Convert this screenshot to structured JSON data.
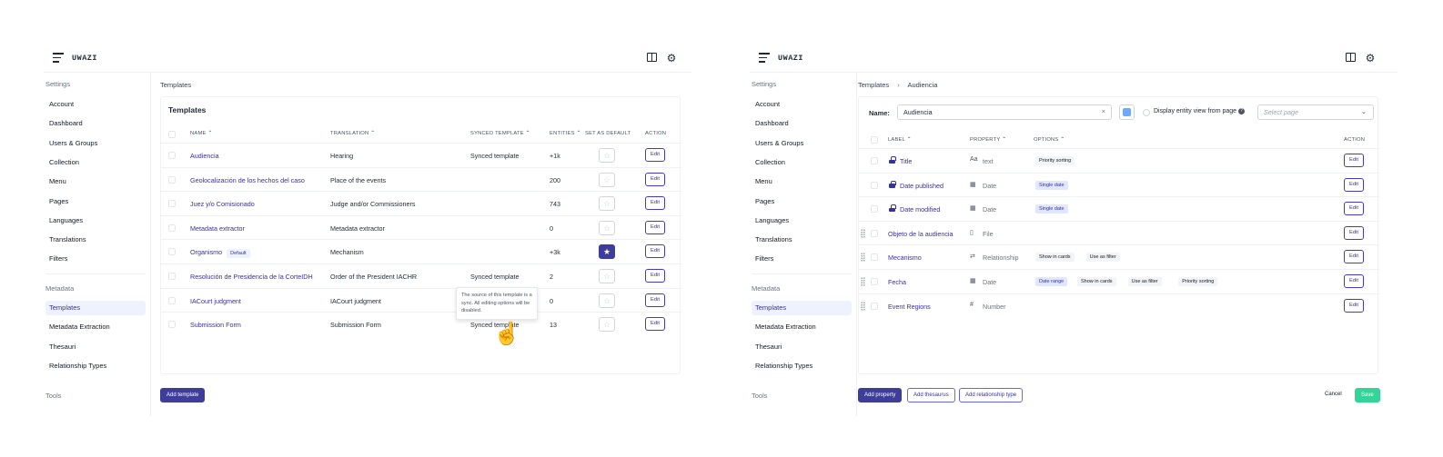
{
  "app": {
    "brand": "UWAZI"
  },
  "sidebar": {
    "settings_heading": "Settings",
    "settings_items": [
      "Account",
      "Dashboard",
      "Users & Groups",
      "Collection",
      "Menu",
      "Pages",
      "Languages",
      "Translations",
      "Filters"
    ],
    "metadata_heading": "Metadata",
    "metadata_items": [
      "Templates",
      "Metadata Extraction",
      "Thesauri",
      "Relationship Types"
    ],
    "tools_heading": "Tools"
  },
  "left": {
    "breadcrumb": "Templates",
    "card_title": "Templates",
    "columns": {
      "name": "NAME",
      "translation": "TRANSLATION",
      "synced": "SYNCED TEMPLATE",
      "entities": "ENTITIES",
      "default": "SET AS DEFAULT",
      "action": "ACTION"
    },
    "default_badge": "Default",
    "edit_label": "Edit",
    "rows": [
      {
        "name": "Audiencia",
        "translation": "Hearing",
        "synced": "Synced template",
        "entities": "+1k",
        "is_default": false
      },
      {
        "name": "Geolocalización de los hechos del caso",
        "translation": "Place of the events",
        "synced": "",
        "entities": "200",
        "is_default": false
      },
      {
        "name": "Juez y/o Comisionado",
        "translation": "Judge and/or Commissioners",
        "synced": "",
        "entities": "743",
        "is_default": false
      },
      {
        "name": "Metadata extractor",
        "translation": "Metadata extractor",
        "synced": "",
        "entities": "0",
        "is_default": false
      },
      {
        "name": "Organismo",
        "translation": "Mechanism",
        "synced": "",
        "entities": "+3k",
        "is_default": true
      },
      {
        "name": "Resolución de Presidencia de la CorteIDH",
        "translation": "Order of the President IACHR",
        "synced": "Synced template",
        "entities": "2",
        "is_default": false
      },
      {
        "name": "IACourt judgment",
        "translation": "IACourt judgment",
        "synced": "",
        "entities": "0",
        "is_default": false
      },
      {
        "name": "Submission Form",
        "translation": "Submission Form",
        "synced": "Synced template",
        "entities": "13",
        "is_default": false
      }
    ],
    "tooltip": "The source of this template is a sync. All editing options will be disabled.",
    "add_button": "Add template"
  },
  "right": {
    "breadcrumb": [
      "Templates",
      "Audiencia"
    ],
    "name_label": "Name:",
    "name_value": "Audiencia",
    "color": "#6ea8ff",
    "display_label": "Display entity view from page",
    "select_placeholder": "Select page",
    "columns": {
      "label": "LABEL",
      "property": "PROPERTY",
      "options": "OPTIONS",
      "action": "ACTION"
    },
    "edit_label": "Edit",
    "properties": [
      {
        "label": "Title",
        "locked": true,
        "icon": "text-icon",
        "glyph": "Aa",
        "type": "text",
        "options": [
          {
            "text": "Priority sorting",
            "blue": false
          }
        ]
      },
      {
        "label": "Date published",
        "locked": true,
        "icon": "calendar-icon",
        "glyph": "▦",
        "type": "Date",
        "options": [
          {
            "text": "Single date",
            "blue": true
          }
        ]
      },
      {
        "label": "Date modified",
        "locked": true,
        "icon": "calendar-icon",
        "glyph": "▦",
        "type": "Date",
        "options": [
          {
            "text": "Single date",
            "blue": true
          }
        ]
      },
      {
        "label": "Objeto de la audiencia",
        "locked": false,
        "icon": "file-icon",
        "glyph": "▯",
        "type": "File",
        "options": []
      },
      {
        "label": "Mecanismo",
        "locked": false,
        "icon": "relationship-icon",
        "glyph": "⇄",
        "type": "Relationship",
        "options": [
          {
            "text": "Show in cards",
            "blue": false
          },
          {
            "text": "Use as filter",
            "blue": false
          }
        ]
      },
      {
        "label": "Fecha",
        "locked": false,
        "icon": "calendar-icon",
        "glyph": "▦",
        "type": "Date",
        "options": [
          {
            "text": "Date range",
            "blue": true
          },
          {
            "text": "Show in cards",
            "blue": false
          },
          {
            "text": "Use as filter",
            "blue": false
          },
          {
            "text": "Priority sorting",
            "blue": false
          }
        ]
      },
      {
        "label": "Event Regions",
        "locked": false,
        "icon": "hash-icon",
        "glyph": "#",
        "type": "Number",
        "options": []
      }
    ],
    "buttons": {
      "add_property": "Add property",
      "add_thesaurus": "Add thesaurus",
      "add_relationship": "Add relationship type",
      "cancel": "Cancel",
      "save": "Save"
    }
  }
}
